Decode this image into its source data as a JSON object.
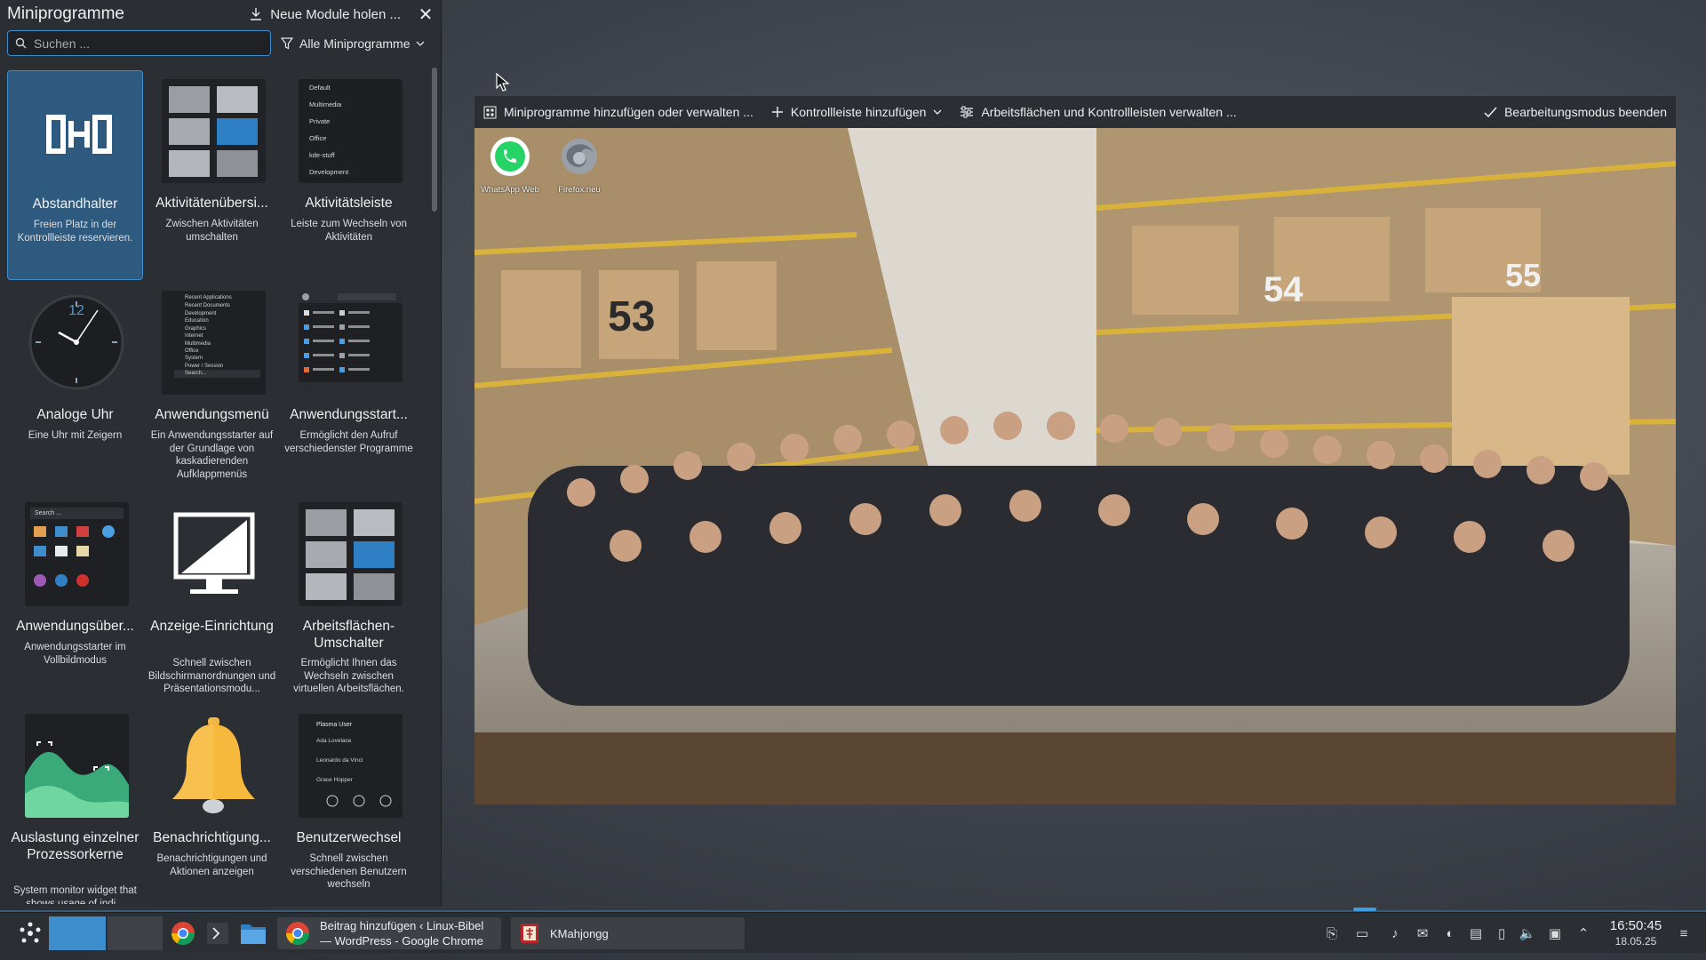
{
  "explorer": {
    "title": "Miniprogramme",
    "get_new_label": "Neue Module holen ...",
    "search_placeholder": "Suchen ...",
    "filter_label": "Alle Miniprogramme",
    "widgets": [
      {
        "name": "Abstandhalter",
        "desc": "Freien Platz in der Kontrollleiste reservieren."
      },
      {
        "name": "Aktivitätenübersi...",
        "desc": "Zwischen Aktivitäten umschalten"
      },
      {
        "name": "Aktivitätsleiste",
        "desc": "Leiste zum Wechseln von Aktivitäten"
      },
      {
        "name": "Analoge Uhr",
        "desc": "Eine Uhr mit Zeigern"
      },
      {
        "name": "Anwendungsmenü",
        "desc": "Ein Anwendungsstarter auf der Grundlage von kaskadierenden Aufklappmenüs"
      },
      {
        "name": "Anwendungsstart...",
        "desc": "Ermöglicht den Aufruf verschiedenster Programme"
      },
      {
        "name": "Anwendungsüber...",
        "desc": "Anwendungsstarter im Vollbildmodus"
      },
      {
        "name": "Anzeige-Einrichtung",
        "desc": "Schnell zwischen Bildschirmanordnungen und Präsentationsmodu..."
      },
      {
        "name": "Arbeitsflächen-Umschalter",
        "desc": "Ermöglicht Ihnen das Wechseln zwischen virtuellen Arbeitsflächen."
      },
      {
        "name": "Auslastung einzelner Prozessorkerne",
        "desc": "System monitor widget that shows usage of indi..."
      },
      {
        "name": "Benachrichtigung...",
        "desc": "Benachrichtigungen und Aktionen anzeigen"
      },
      {
        "name": "Benutzerwechsel",
        "desc": "Schnell zwischen verschiedenen Benutzern wechseln"
      }
    ],
    "activity_bar_items": [
      "Default",
      "Multimedia",
      "Private",
      "Office",
      "kde-stuff",
      "Development"
    ],
    "app_menu_items": [
      "Recent Applications",
      "Recent Documents",
      "Development",
      "Education",
      "Graphics",
      "Internet",
      "Multimedia",
      "Office",
      "System",
      "Power / Session",
      "Search..."
    ],
    "user_switch_items": [
      "Plasma User",
      "Ada Lovelace",
      "Leonardo da Vinci",
      "Grace Hopper"
    ],
    "overview_search": "Search ...",
    "clock_twelve": "12"
  },
  "toolbar": {
    "add_widgets": "Miniprogramme hinzufügen oder verwalten ...",
    "add_panel": "Kontrollleiste hinzufügen",
    "manage_desktops": "Arbeitsflächen und Kontrollleisten verwalten ...",
    "exit_edit": "Bearbeitungsmodus beenden"
  },
  "desktop": {
    "icons": [
      {
        "label": "WhatsApp Web",
        "icon": "whatsapp-icon"
      },
      {
        "label": "Firefox.neu",
        "icon": "firefox-icon"
      }
    ],
    "aisle_numbers": [
      "53",
      "54",
      "55"
    ]
  },
  "taskbar": {
    "tasks": [
      {
        "label": "Beitrag hinzufügen ‹ Linux-Bibel — WordPress - Google Chrome"
      },
      {
        "label": "KMahjongg"
      }
    ],
    "clock_time": "16:50:45",
    "clock_date": "18.05.25"
  },
  "colors": {
    "accent": "#3d8ccb",
    "panel_bg": "#2b2e33",
    "selected_tile": "#2f5a80"
  }
}
